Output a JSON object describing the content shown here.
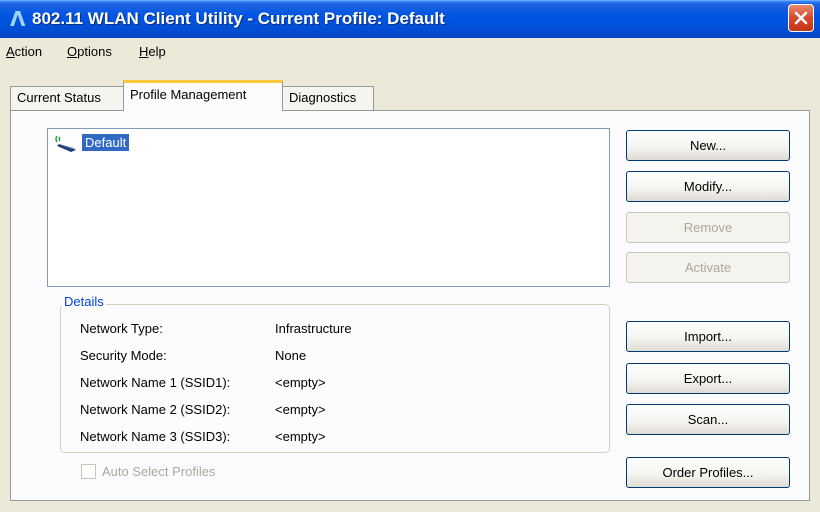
{
  "window": {
    "title": "802.11 WLAN Client Utility - Current Profile: Default",
    "app_icon": "wlan-lambda-icon",
    "close_icon": "close-icon"
  },
  "menu": {
    "items": [
      {
        "label": "Action"
      },
      {
        "label": "Options"
      },
      {
        "label": "Help"
      }
    ]
  },
  "tabs": [
    {
      "label": "Current Status",
      "active": false
    },
    {
      "label": "Profile Management",
      "active": true
    },
    {
      "label": "Diagnostics",
      "active": false
    }
  ],
  "profiles": {
    "items": [
      {
        "name": "Default",
        "selected": true,
        "icon": "wireless-profile-icon"
      }
    ]
  },
  "buttons": {
    "new": "New...",
    "modify": "Modify...",
    "remove": "Remove",
    "activate": "Activate",
    "import": "Import...",
    "export": "Export...",
    "scan": "Scan...",
    "order_profiles": "Order Profiles..."
  },
  "details": {
    "legend": "Details",
    "rows": [
      {
        "label": "Network Type:",
        "value": "Infrastructure"
      },
      {
        "label": "Security Mode:",
        "value": "None"
      },
      {
        "label": "Network Name 1 (SSID1):",
        "value": "<empty>"
      },
      {
        "label": "Network Name 2 (SSID2):",
        "value": "<empty>"
      },
      {
        "label": "Network Name 3 (SSID3):",
        "value": "<empty>"
      }
    ]
  },
  "auto_select": {
    "label": "Auto Select Profiles",
    "checked": false,
    "enabled": false
  },
  "colors": {
    "titlebar": "#0054E3",
    "selection": "#316AC5",
    "details_legend": "#0046D5",
    "active_tab_accent": "#FFC83C"
  }
}
